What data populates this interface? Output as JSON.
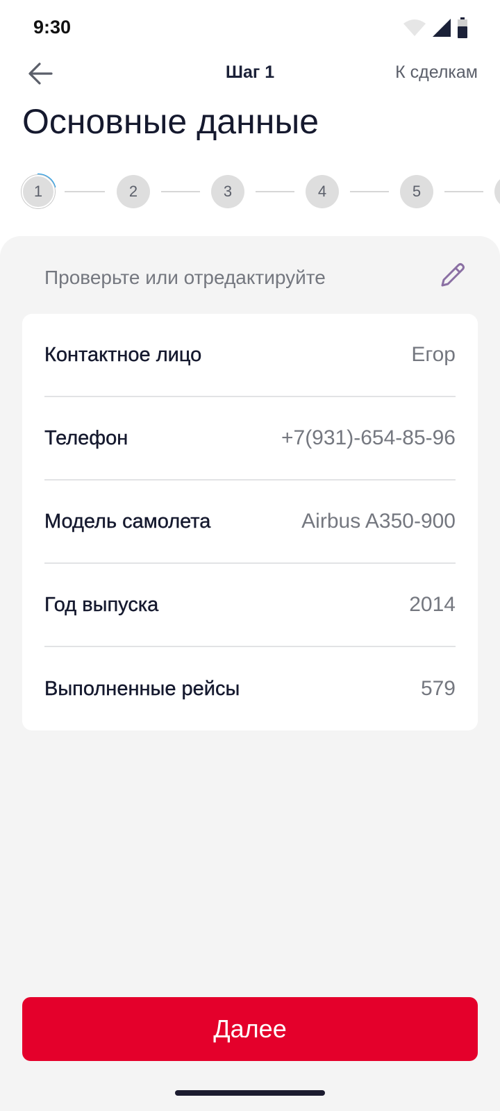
{
  "status_bar": {
    "time": "9:30",
    "icons": [
      "wifi-icon",
      "signal-icon",
      "battery-icon"
    ]
  },
  "header": {
    "back_icon": "arrow-left-icon",
    "step_title": "Шаг 1",
    "to_deals": "К сделкам"
  },
  "page_title": "Основные данные",
  "stepper": {
    "steps": [
      "1",
      "2",
      "3",
      "4",
      "5"
    ],
    "current": 1,
    "accent": "#2b9fe6"
  },
  "hint": {
    "text": "Проверьте или отредактируйте",
    "edit_icon": "pencil-icon",
    "edit_color": "#8a6fa3"
  },
  "info_rows": [
    {
      "label": "Контактное лицо",
      "value": "Егор"
    },
    {
      "label": "Телефон",
      "value": "+7(931)-654-85-96"
    },
    {
      "label": "Модель самолета",
      "value": "Airbus A350-900"
    },
    {
      "label": "Год выпуска",
      "value": "2014"
    },
    {
      "label": "Выполненные рейсы",
      "value": "579"
    }
  ],
  "next_button": {
    "label": "Далее",
    "color": "#e4002b"
  }
}
